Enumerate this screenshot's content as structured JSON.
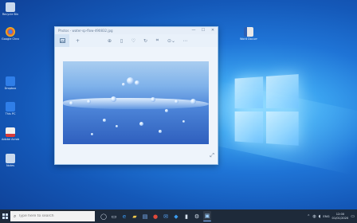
{
  "window": {
    "title": "Photos - water-sp-flow-490832.jpg",
    "controls": {
      "minimize": "—",
      "maximize": "☐",
      "close": "✕"
    }
  },
  "toolbar": {
    "icons": [
      "image-icon",
      "add-icon",
      "zoom-icon",
      "delete-icon",
      "heart-icon",
      "rotate-icon",
      "crop-icon",
      "edit-icon",
      "more-icon"
    ]
  },
  "desktop_icons": [
    {
      "label": "Recycle Bin",
      "color": "#c9d9ee"
    },
    {
      "label": "Google Chrome",
      "color": "#e04a3b"
    },
    {
      "label": "Dropbox",
      "color": "#2f7ee8"
    },
    {
      "label": "This PC",
      "color": "#2f7ee8"
    },
    {
      "label": "Adobe Acrobat",
      "color": "#d93b3b"
    },
    {
      "label": "Notes",
      "color": "#c9d9ee"
    },
    {
      "label": "Word Document",
      "color": "#e8e8e8"
    }
  ],
  "taskbar": {
    "search_placeholder": "Type here to search",
    "lang": "ENG",
    "time": "12:00",
    "date": "01/01/2020"
  },
  "colors": {
    "taskbar_bg": "#1e2a3a",
    "window_bg": "#eef4fb"
  }
}
